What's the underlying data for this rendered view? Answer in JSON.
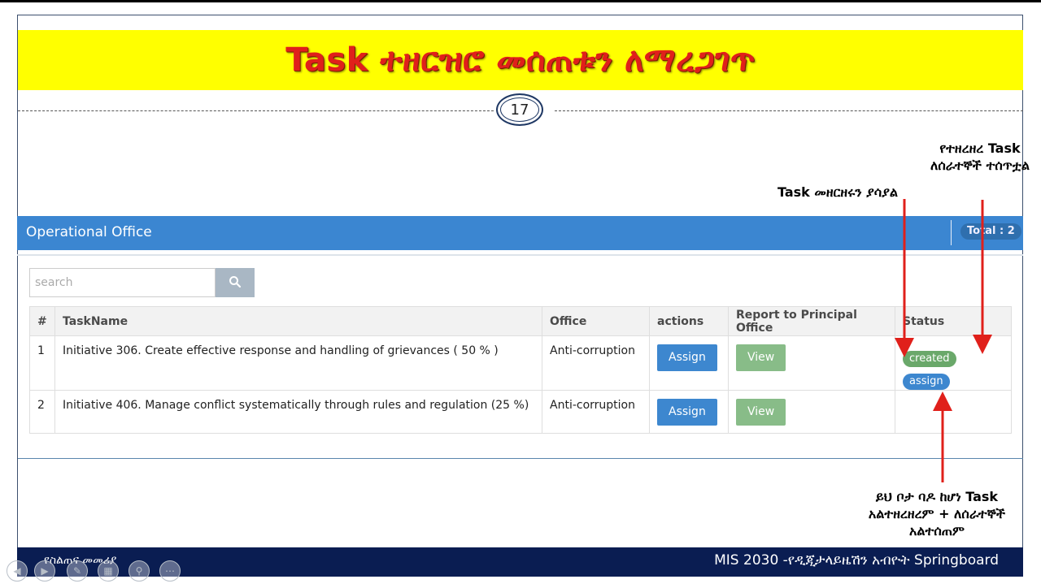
{
  "slide": {
    "title": "Task ተዘርዝሮ መሰጠቱን ለማረጋገጥ",
    "page_number": "17",
    "annotations": {
      "detail_shown": "Task መዘርዘሩን ያሳያል",
      "assigned_to_staff": "የተዘረዘረ Task ለሰራተኞች ተሰጥቷል",
      "empty_means": "ይህ ቦታ ባዶ ከሆነ Task አልተዘረዘረም + ለሰራተኞች አልተሰጠም"
    },
    "footer_left": "የስልጠና መመሪያ",
    "footer_right": "MIS 2030 -የዲጂታላይዜሽን አብዮት Springboard",
    "colors": {
      "title_band": "#ffff00",
      "title_text": "#e0201b",
      "panel_header": "#3b86d1",
      "footer": "#0a1d52",
      "arrow": "#e0201b"
    }
  },
  "panel": {
    "title": "Operational Office",
    "total_label": "Total : 2"
  },
  "search": {
    "placeholder": "search",
    "button_icon": "search-icon"
  },
  "table": {
    "columns": [
      "#",
      "TaskName",
      "Office",
      "actions",
      "Report to Principal Office",
      "Status"
    ],
    "rows": [
      {
        "num": "1",
        "task": "Initiative 306. Create effective response and handling of grievances ( 50 % )",
        "office": "Anti-corruption",
        "action": "Assign",
        "report": "View",
        "status": [
          "created",
          "assign"
        ]
      },
      {
        "num": "2",
        "task": "Initiative 406. Manage conflict systematically through rules and regulation (25 %)",
        "office": "Anti-corruption",
        "action": "Assign",
        "report": "View",
        "status": []
      }
    ]
  }
}
